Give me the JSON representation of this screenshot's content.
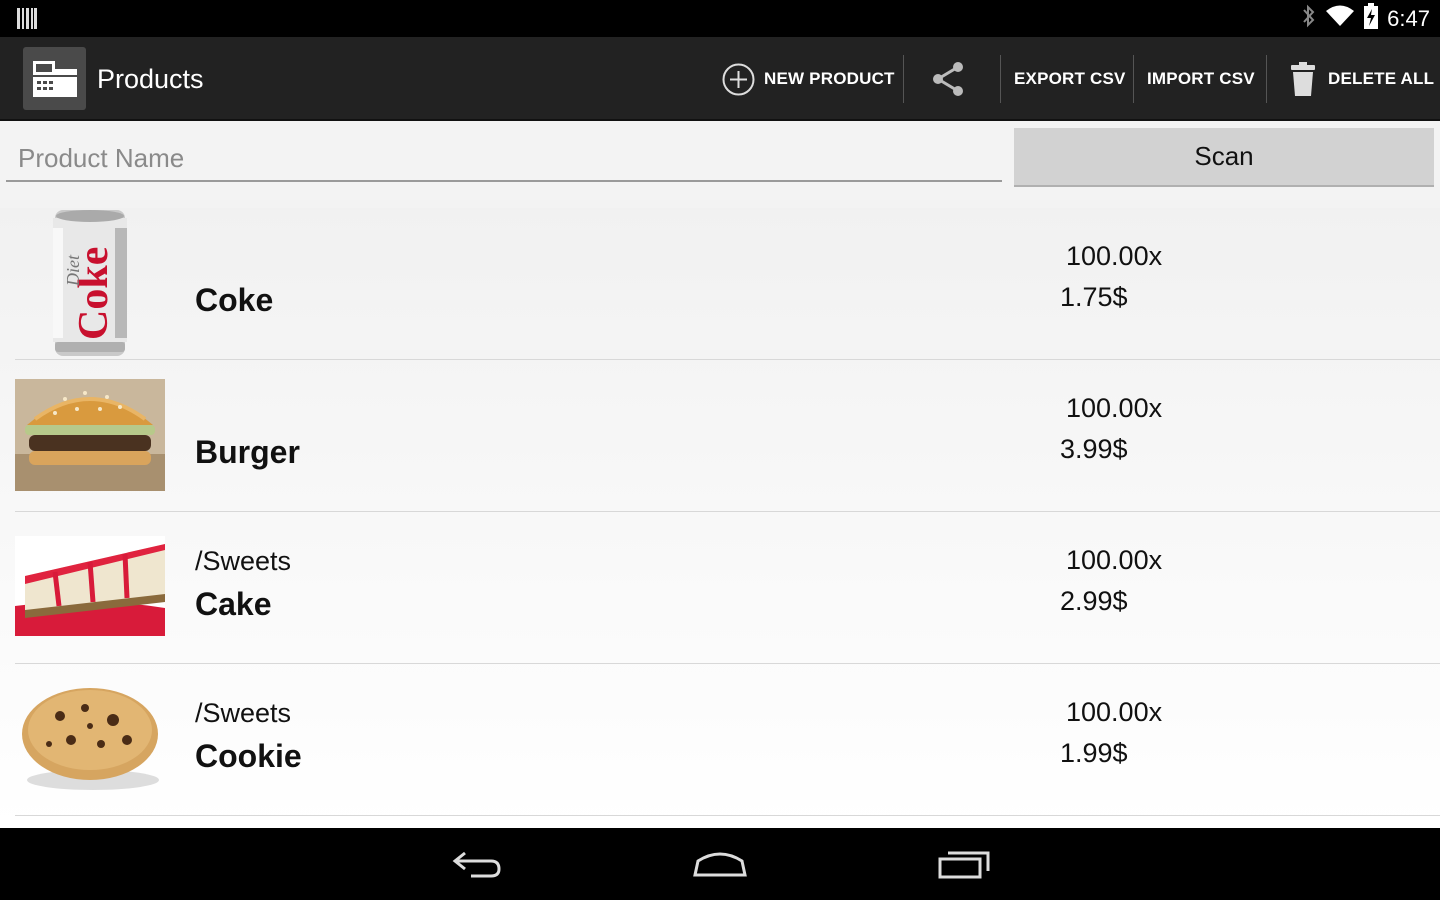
{
  "status_bar": {
    "time": "6:47",
    "icons": [
      "barcode-notification-icon",
      "bluetooth-icon",
      "wifi-icon",
      "battery-charging-icon"
    ]
  },
  "action_bar": {
    "title": "Products",
    "new_product_label": "NEW PRODUCT",
    "export_label": "EXPORT CSV",
    "import_label": "IMPORT CSV",
    "delete_all_label": "DELETE ALL",
    "icons": [
      "app-logo-icon",
      "add-circle-icon",
      "share-icon",
      "trash-icon"
    ]
  },
  "search": {
    "placeholder": "Product Name",
    "value": "",
    "scan_label": "Scan"
  },
  "products": [
    {
      "category": "",
      "name": "Coke",
      "quantity": "100.00x",
      "price": "1.75$",
      "image": "diet-coke-can"
    },
    {
      "category": "",
      "name": "Burger",
      "quantity": "100.00x",
      "price": "3.99$",
      "image": "burger"
    },
    {
      "category": "/Sweets",
      "name": "Cake",
      "quantity": "100.00x",
      "price": "2.99$",
      "image": "cheesecake-slice"
    },
    {
      "category": "/Sweets",
      "name": "Cookie",
      "quantity": "100.00x",
      "price": "1.99$",
      "image": "chocolate-chip-cookie"
    }
  ],
  "thumb_text": {
    "coke_logo": "Coke",
    "diet": "Diet"
  },
  "nav_bar": {
    "icons": [
      "back-icon",
      "home-icon",
      "recent-apps-icon"
    ]
  },
  "colors": {
    "action_bar": "#222222",
    "status_bar": "#000000",
    "scan_button": "#d2d2d2",
    "list_bg": "#f1f1f1"
  }
}
